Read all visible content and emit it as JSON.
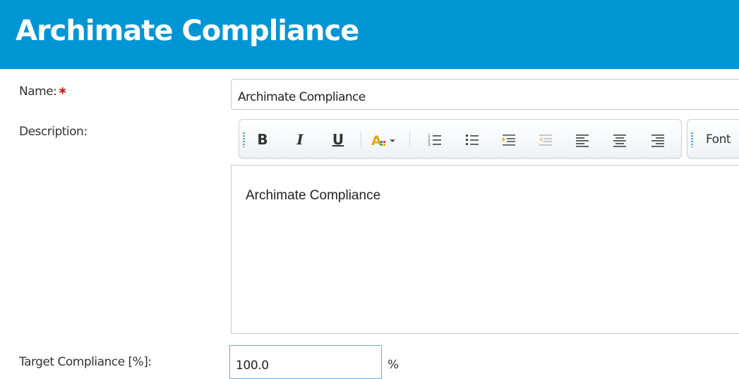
{
  "header": {
    "title": "Archimate Compliance",
    "background": "#0096d6"
  },
  "form": {
    "name_label": "Name:",
    "required_marker": "*",
    "name_value": "Archimate Compliance",
    "description_label": "Description:",
    "description_text": "Archimate Compliance",
    "target_label": "Target Compliance [%]:",
    "target_value": "100.0",
    "target_unit": "%"
  },
  "toolbar": {
    "buttons": [
      {
        "name": "bold-icon",
        "label": "B"
      },
      {
        "name": "italic-icon",
        "label": "I"
      },
      {
        "name": "underline-icon",
        "label": "U"
      },
      {
        "name": "font-color-icon",
        "label": "A"
      },
      {
        "name": "ordered-list-icon",
        "label": ""
      },
      {
        "name": "unordered-list-icon",
        "label": ""
      },
      {
        "name": "indent-icon",
        "label": ""
      },
      {
        "name": "outdent-icon",
        "label": ""
      },
      {
        "name": "align-left-icon",
        "label": ""
      },
      {
        "name": "align-center-icon",
        "label": ""
      },
      {
        "name": "align-right-icon",
        "label": ""
      }
    ],
    "font_label": "Font"
  }
}
